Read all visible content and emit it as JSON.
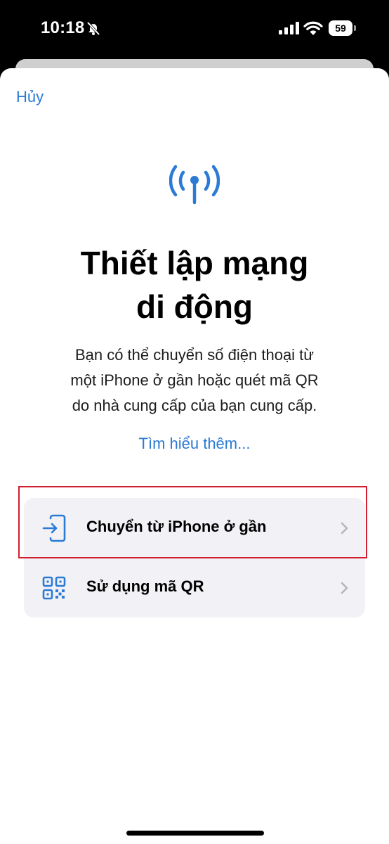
{
  "status_bar": {
    "time": "10:18",
    "battery": "59"
  },
  "nav": {
    "cancel_label": "Hủy"
  },
  "header": {
    "title_lines": [
      "Thiết lập mạng",
      "di động"
    ],
    "description_lines": [
      "Bạn có thể chuyển số điện thoại từ",
      "một iPhone ở gần hoặc quét mã QR",
      "do nhà cung cấp của bạn cung cấp."
    ],
    "learn_more": "Tìm hiểu thêm..."
  },
  "options": [
    {
      "label": "Chuyển từ iPhone ở gần",
      "icon": "transfer-phone-icon"
    },
    {
      "label": "Sử dụng mã QR",
      "icon": "qr-code-icon"
    }
  ],
  "colors": {
    "accent": "#2a7ad6",
    "highlight": "#d21f2f",
    "list_bg": "#f2f2f6"
  }
}
